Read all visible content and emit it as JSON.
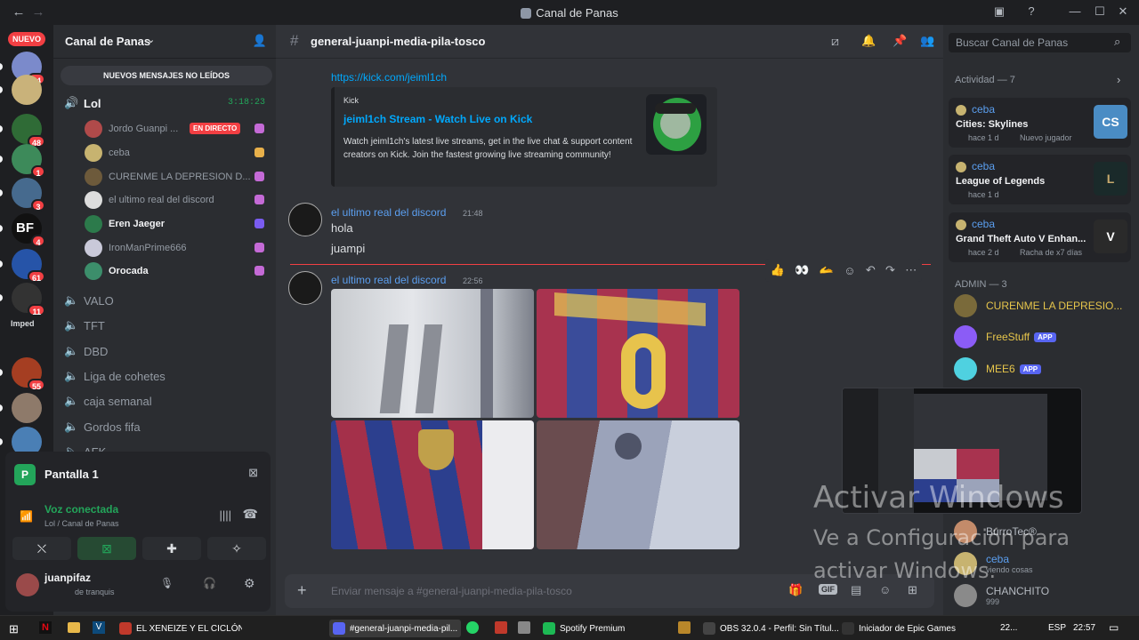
{
  "window": {
    "title": "Canal de Panas"
  },
  "rail": {
    "new_badge": "NUEVO",
    "servers": [
      {
        "badge": "44",
        "color": "#7b8acb"
      },
      {
        "badge": "",
        "color": "#c9b27a"
      },
      {
        "badge": "48",
        "color": "#2f6b36"
      },
      {
        "badge": "1",
        "color": "#3d8a5a"
      },
      {
        "badge": "3",
        "color": "#466a8e"
      },
      {
        "badge": "4",
        "color": "#111111"
      },
      {
        "badge": "61",
        "color": "#2654a8"
      },
      {
        "badge": "11",
        "color": "#333333"
      },
      {
        "badge": "55",
        "color": "#a53e22"
      },
      {
        "badge": "",
        "color": "#8e7a6a"
      },
      {
        "badge": "",
        "color": "#4a7fb5"
      }
    ],
    "server_label_bf": "BF",
    "server_label_imped": "Imped"
  },
  "sidebar": {
    "guild_name": "Canal de Panas",
    "new_unread": "NUEVOS MENSAJES NO LEÍDOS",
    "active_channel": "Lol",
    "active_timer": "3:18:23",
    "members": [
      {
        "name": "Jordo Guanpi ...",
        "live": "EN DIRECTO",
        "color": "#b04a4a"
      },
      {
        "name": "ceba",
        "color": "#c7b370"
      },
      {
        "name": "CURENME LA DEPRESION D...",
        "color": "#6d5a3b"
      },
      {
        "name": "el ultimo real del discord",
        "color": "#dddddd"
      },
      {
        "name": "Eren Jaeger",
        "color": "#2c7a4b"
      },
      {
        "name": "IronManPrime666",
        "color": "#c9c9d9"
      },
      {
        "name": "Orocada",
        "color": "#3c8e6b"
      }
    ],
    "channels": [
      "VALO",
      "TFT",
      "DBD",
      "Liga de cohetes",
      "caja semanal",
      "Gordos fifa",
      "AFK"
    ]
  },
  "voice_panel": {
    "stream_label": "Pantalla 1",
    "status": "Voz conectada",
    "location": "Lol / Canal de Panas"
  },
  "user_panel": {
    "username": "juanpifaz",
    "status": "de tranquis"
  },
  "chat": {
    "channel": "general-juanpi-media-pila-tosco",
    "link": "https://kick.com/jeiml1ch",
    "embed": {
      "provider": "Kick",
      "title": "jeiml1ch Stream - Watch Live on Kick",
      "description": "Watch jeiml1ch's latest live streams, get in the live chat & support content creators on Kick. Join the fastest growing live streaming community!"
    },
    "messages": [
      {
        "author": "el ultimo real del discord",
        "time": "21:48",
        "lines": [
          "hola",
          "juampi"
        ]
      },
      {
        "author": "el ultimo real del discord",
        "time": "22:56"
      }
    ],
    "reactions": [
      "👍",
      "👀",
      "🫴"
    ],
    "composer_placeholder": "Enviar mensaje a #general-juanpi-media-pila-tosco"
  },
  "members": {
    "search_placeholder": "Buscar Canal de Panas",
    "activity_header": "Actividad — 7",
    "activities": [
      {
        "user": "ceba",
        "game": "Cities: Skylines",
        "meta": "hace 1 d",
        "tag": "Nuevo jugador",
        "icon": "CS"
      },
      {
        "user": "ceba",
        "game": "League of Legends",
        "meta": "hace 1 d",
        "tag": "",
        "icon": "L"
      },
      {
        "user": "ceba",
        "game": "Grand Theft Auto V Enhan...",
        "meta": "hace 2 d",
        "tag": "Racha de x7 días",
        "icon": "V"
      }
    ],
    "admin_header": "ADMIN — 3",
    "admins": [
      {
        "name": "CURENME LA DEPRESIO...",
        "app": "",
        "color": "#e6c54b"
      },
      {
        "name": "FreeStuff",
        "app": "APP",
        "color": "#e6c54b"
      },
      {
        "name": "MEE6",
        "app": "APP",
        "color": "#e6c54b"
      }
    ],
    "others": [
      {
        "name": "BurroTec®",
        "sub": ""
      },
      {
        "name": "ceba",
        "sub": "viendo cosas"
      },
      {
        "name": "CHANCHITO",
        "sub": "999"
      }
    ]
  },
  "watermark": {
    "line1": "Activar Windows",
    "line2": "Ve a Configuración para",
    "line3": "activar Windows."
  },
  "taskbar": {
    "items": [
      {
        "label": "EL XENEIZE Y EL CICLÓN E...",
        "color": "#c0392b"
      },
      {
        "label": "#general-juanpi-media-pil...",
        "color": "#5865f2"
      },
      {
        "label": "Spotify Premium",
        "color": "#1db954"
      },
      {
        "label": "OBS 32.0.4 - Perfil: Sin Títul...",
        "color": "#444444"
      },
      {
        "label": "Iniciador de Epic Games",
        "color": "#333333"
      }
    ],
    "temp": "22...",
    "lang": "ESP",
    "time": "22:57"
  }
}
